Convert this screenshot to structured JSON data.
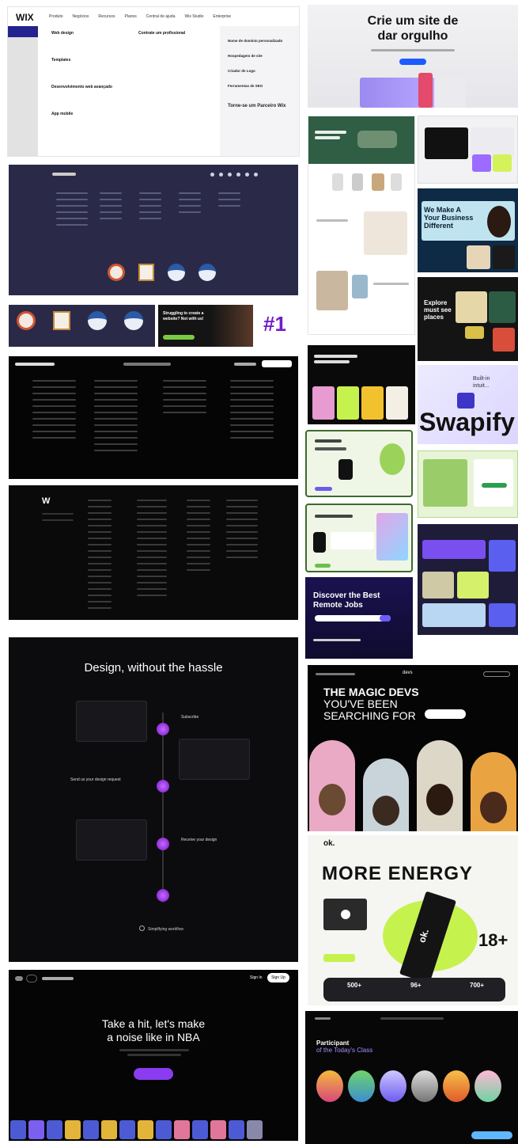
{
  "wix": {
    "logo": "WIX",
    "nav": [
      "Produto",
      "Negócios",
      "Recursos",
      "Planos",
      "Central de ajuda",
      "Wix Studio",
      "Enterprise"
    ],
    "menu_left": [
      "Web design",
      "Templates",
      "Desenvolvimento web avançado",
      "App mobile"
    ],
    "menu_mid": [
      "Contrate um profissional"
    ],
    "menu_right": [
      "Nome de domínio personalizado",
      "Hospedagem de site",
      "Criador de Logo",
      "Ferramentas de SEO"
    ],
    "promo_title": "Torne-se um Parceiro Wix"
  },
  "hero_pt": {
    "title_line1": "Crie um site de",
    "title_line2": "dar orgulho"
  },
  "rank_label": "#1",
  "banner_small": {
    "line1": "Struggling to create a",
    "line2": "website? Not with us!"
  },
  "design_section": {
    "title": "Design, without the hassle",
    "steps": [
      "Subscribe",
      "Send us your design request",
      "Receive your design"
    ],
    "footer": "Simplifying workflow"
  },
  "nba": {
    "title_line1": "Take a hit, let's make",
    "title_line2": "a noise like in NBA",
    "sign_in": "Sign In",
    "sign_up": "Sign Up"
  },
  "we_make": {
    "line1": "We Make A",
    "line2": "Your Business",
    "line3": "Different"
  },
  "explore": {
    "line1": "Explore",
    "line2": "must see",
    "line3": "places"
  },
  "swapify": {
    "brand": "Swapify",
    "tag_line1": "Built-in",
    "tag_line2": "intuit..."
  },
  "jobs": {
    "line1": "Discover the Best",
    "line2": "Remote Jobs"
  },
  "magic": {
    "line1": "THE MAGIC DEVS",
    "line2": "YOU'VE BEEN",
    "line3": "SEARCHING FOR",
    "nav_logo": "devs"
  },
  "energy": {
    "logo": "ok.",
    "title": "MORE ENERGY",
    "age": "18+",
    "stats": [
      "500+",
      "96+",
      "700+"
    ],
    "can_text": "ok."
  },
  "participant": {
    "line1": "Participant",
    "line2": "of the Today's Class"
  },
  "colors": {
    "wix_dark": "#2a2a48",
    "purple": "#8a2be2",
    "lime": "#c6f24e",
    "black": "#0c0c0e"
  }
}
